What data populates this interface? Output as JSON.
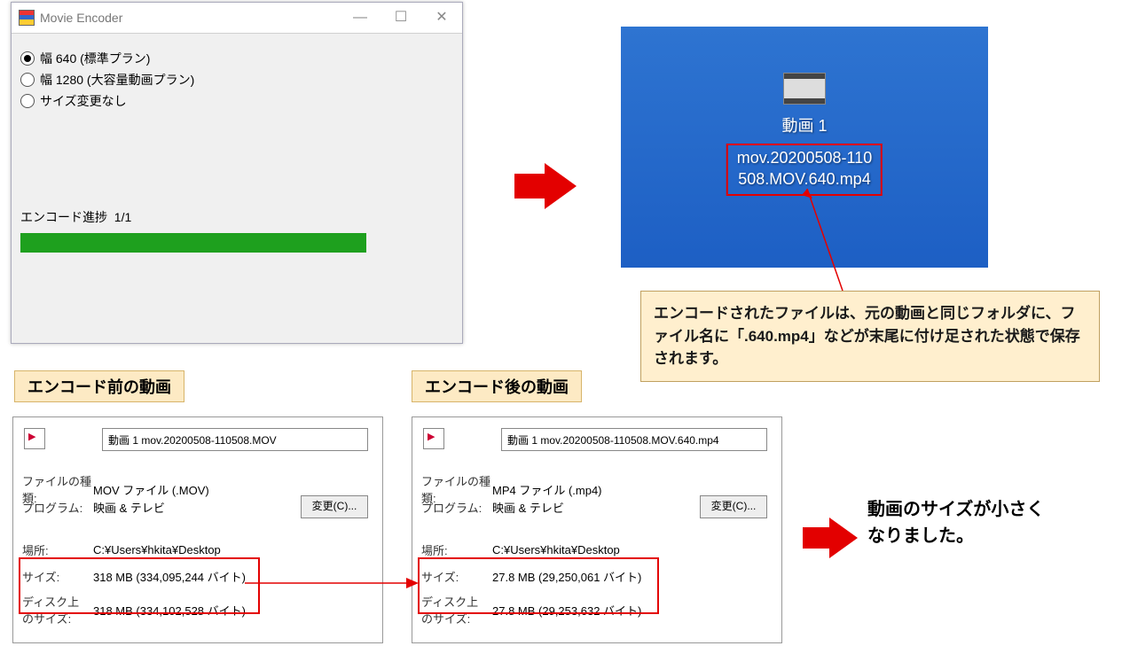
{
  "encoder": {
    "title": "Movie Encoder",
    "options": {
      "opt1": "幅 640 (標準プラン)",
      "opt2": "幅 1280 (大容量動画プラン)",
      "opt3": "サイズ変更なし"
    },
    "progress_label": "エンコード進捗",
    "progress_count": "1/1"
  },
  "desktop": {
    "caption": "動画 1",
    "filename_line1": "mov.20200508-110",
    "filename_line2": "508.MOV.640.mp4"
  },
  "note_text": "エンコードされたファイルは、元の動画と同じフォルダに、ファイル名に「.640.mp4」などが末尾に付け足された状態で保存されます。",
  "heading_before": "エンコード前の動画",
  "heading_after": "エンコード後の動画",
  "props_labels": {
    "file_type": "ファイルの種類:",
    "program": "プログラム:",
    "location": "場所:",
    "size": "サイズ:",
    "disk_size": "ディスク上\nのサイズ:",
    "change_btn": "変更(C)..."
  },
  "props_before": {
    "filename": "動画 1 mov.20200508-110508.MOV",
    "file_type": "MOV ファイル (.MOV)",
    "program": "映画 & テレビ",
    "location": "C:¥Users¥hkita¥Desktop",
    "size": "318 MB (334,095,244 バイト)",
    "disk_size": "318 MB (334,102,528 バイト)"
  },
  "props_after": {
    "filename": "動画 1 mov.20200508-110508.MOV.640.mp4",
    "file_type": "MP4 ファイル (.mp4)",
    "program": "映画 & テレビ",
    "location": "C:¥Users¥hkita¥Desktop",
    "size": "27.8 MB (29,250,061 バイト)",
    "disk_size": "27.8 MB (29,253,632 バイト)"
  },
  "result_text_l1": "動画のサイズが小さく",
  "result_text_l2": "なりました。"
}
